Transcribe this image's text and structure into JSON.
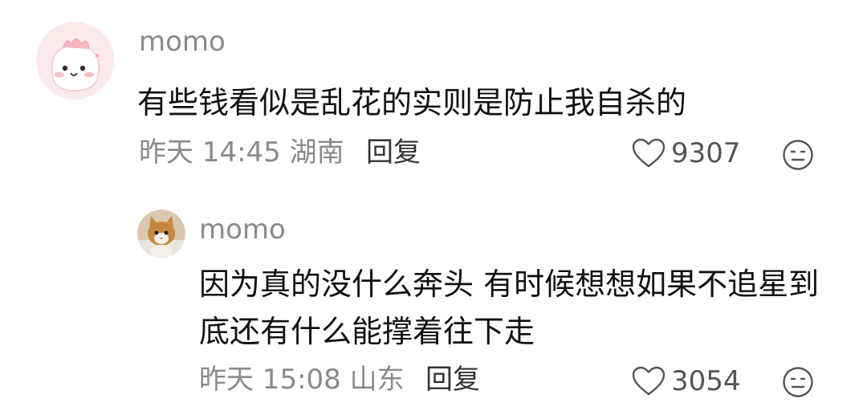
{
  "comments": [
    {
      "username": "momo",
      "text": "有些钱看似是乱花的实则是防止我自杀的",
      "time": "昨天 14:45",
      "location": "湖南",
      "reply_label": "回复",
      "likes": "9307",
      "avatar_icon": "pink-cartoon-avatar"
    }
  ],
  "replies": [
    {
      "username": "momo",
      "text": "因为真的没什么奔头 有时候想想如果不追星到底还有什么能撑着往下走",
      "time": "昨天 15:08",
      "location": "山东",
      "reply_label": "回复",
      "likes": "3054",
      "avatar_icon": "cat-photo-avatar"
    }
  ],
  "icons": {
    "like": "heart-outline-icon",
    "emoji": "emoji-face-icon"
  },
  "colors": {
    "meta_gray": "#8a8a8a",
    "text_black": "#111111",
    "avatar_pink": "#fbe9ec"
  }
}
